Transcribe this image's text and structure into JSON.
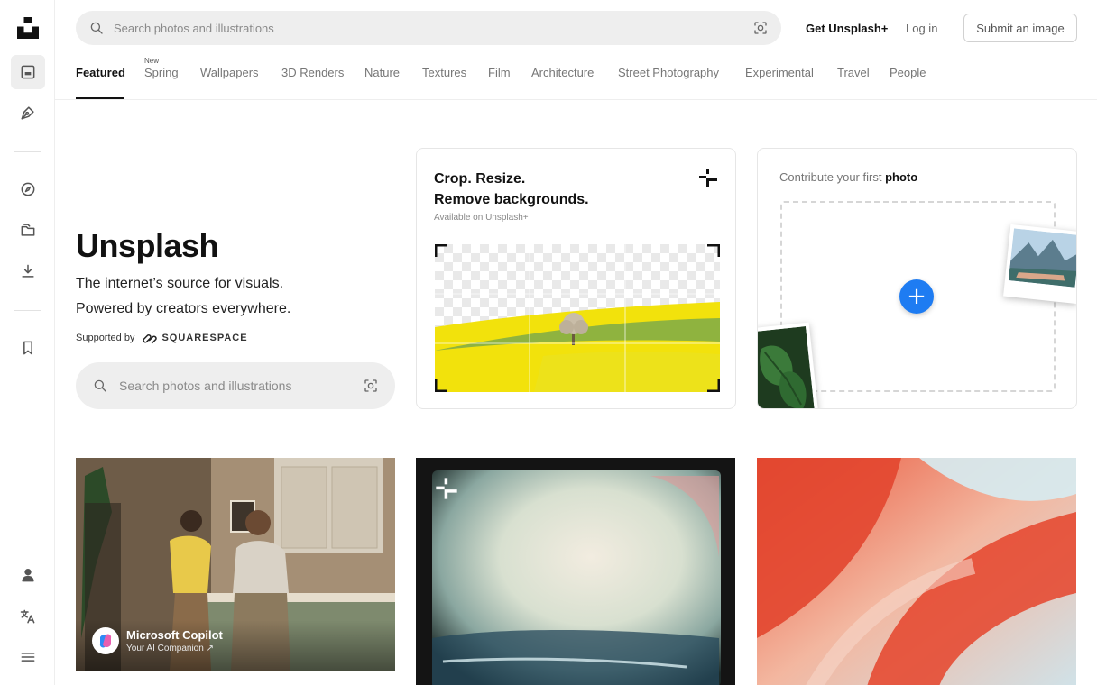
{
  "header": {
    "search_placeholder": "Search photos and illustrations",
    "get_plus": "Get Unsplash+",
    "login": "Log in",
    "submit": "Submit an image"
  },
  "tabs": {
    "items": [
      {
        "label": "Featured",
        "active": true
      },
      {
        "label": "Spring",
        "badge": "New"
      },
      {
        "label": "Wallpapers"
      },
      {
        "label": "3D Renders"
      },
      {
        "label": "Nature"
      },
      {
        "label": "Textures"
      },
      {
        "label": "Film"
      },
      {
        "label": "Architecture"
      },
      {
        "label": "Street Photography"
      },
      {
        "label": "Experimental"
      },
      {
        "label": "Travel"
      },
      {
        "label": "People"
      }
    ]
  },
  "hero": {
    "title": "Unsplash",
    "subtitle_line1": "The internet’s source for visuals.",
    "subtitle_line2": "Powered by creators everywhere.",
    "supported_by": "Supported by",
    "sponsor_name": "SQUARESPACE",
    "search_placeholder": "Search photos and illustrations"
  },
  "promo_card": {
    "title_line1": "Crop. Resize.",
    "title_line2": "Remove backgrounds.",
    "availability": "Available on Unsplash+"
  },
  "contribute_card": {
    "title_prefix": "Contribute your first",
    "title_bold": "photo"
  },
  "photos": {
    "first_sponsor_name": "Microsoft Copilot",
    "first_sponsor_tagline": "Your AI Companion ↗"
  },
  "sidebar": {
    "icons": [
      "unsplash-logo",
      "photos-icon",
      "illustrations-icon",
      "explore-icon",
      "collections-icon",
      "download-icon",
      "bookmark-icon",
      "account-icon",
      "language-icon",
      "menu-icon"
    ]
  },
  "colors": {
    "accent_blue": "#1e7cf2",
    "search_bg": "#eeeeee",
    "text_primary": "#111111",
    "text_muted": "#767676"
  }
}
